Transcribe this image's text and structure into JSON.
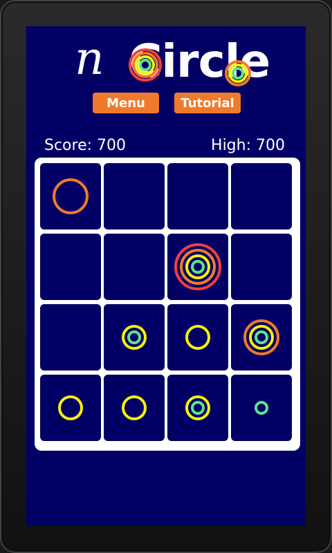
{
  "app": {
    "title_prefix": "n",
    "title_main": "Circle"
  },
  "buttons": {
    "menu_label": "Menu",
    "tutorial_label": "Tutorial"
  },
  "scores": {
    "score_text": "Score: 700",
    "high_text": "High: 700"
  },
  "colors": {
    "background": "#020064",
    "accent": "#f07a2b",
    "ring_colors": {
      "green": "#5ce58c",
      "yellow": "#f7f200",
      "orange": "#f07a2b",
      "red": "#f04040"
    }
  },
  "board": {
    "rows": [
      [
        [
          "orange"
        ],
        [],
        [],
        []
      ],
      [
        [],
        [],
        [
          "green",
          "yellow",
          "orange",
          "red"
        ],
        []
      ],
      [
        [],
        [
          "green",
          "yellow"
        ],
        [
          "yellow"
        ],
        [
          "green",
          "yellow",
          "orange"
        ]
      ],
      [
        [
          "yellow"
        ],
        [
          "yellow"
        ],
        [
          "green",
          "yellow"
        ],
        [
          "green"
        ]
      ]
    ]
  }
}
